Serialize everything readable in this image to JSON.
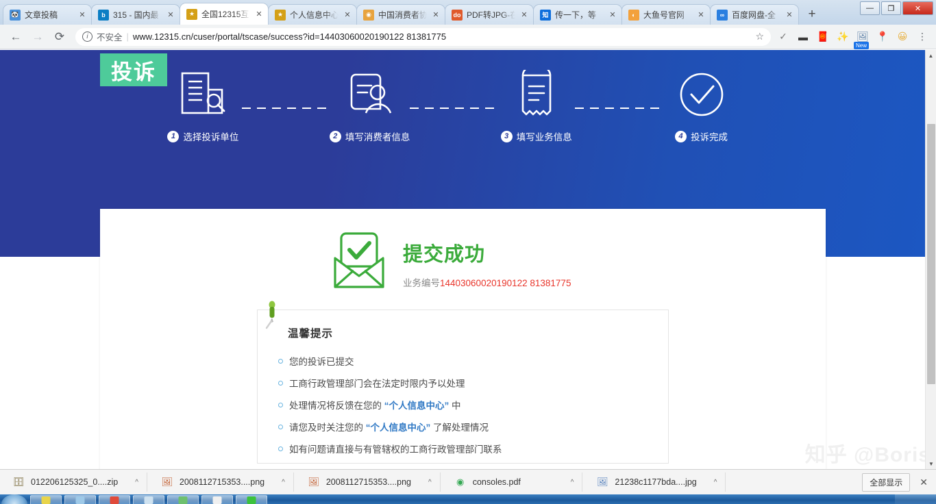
{
  "browser": {
    "tabs": [
      {
        "title": "文章投稿",
        "favicon": "panda-icon",
        "favicon_color": "#4a90d9",
        "favicon_text": "🐼",
        "active": false
      },
      {
        "title": "315 - 国内最",
        "favicon": "bing-icon",
        "favicon_color": "#0b7ec4",
        "favicon_text": "b",
        "active": false
      },
      {
        "title": "全国12315互",
        "favicon": "emblem-icon",
        "favicon_color": "#d4a017",
        "favicon_text": "★",
        "active": true
      },
      {
        "title": "个人信息中心",
        "favicon": "emblem-icon",
        "favicon_color": "#d4a017",
        "favicon_text": "★",
        "active": false
      },
      {
        "title": "中国消费者协",
        "favicon": "pin-icon",
        "favicon_color": "#e8a33d",
        "favicon_text": "◉",
        "active": false
      },
      {
        "title": "PDF转JPG-在",
        "favicon": "docsmall-icon",
        "favicon_color": "#e05a2b",
        "favicon_text": "do",
        "active": false
      },
      {
        "title": "传一下，等",
        "favicon": "zhihu-icon",
        "favicon_color": "#0f6fdc",
        "favicon_text": "知",
        "active": false
      },
      {
        "title": "大鱼号官网",
        "favicon": "dayu-icon",
        "favicon_color": "#f3a13c",
        "favicon_text": "◐",
        "active": false
      },
      {
        "title": "百度网盘-全",
        "favicon": "baidu-icon",
        "favicon_color": "#2a7fe0",
        "favicon_text": "∞",
        "active": false
      }
    ],
    "new_tab_label": "+",
    "tab_close_label": "✕",
    "window_controls": {
      "minimize": "—",
      "maximize": "❐",
      "close": "✕"
    },
    "nav": {
      "back": "←",
      "forward": "→",
      "reload": "⟳"
    },
    "omnibox": {
      "security_label": "不安全",
      "url": "www.12315.cn/cuser/portal/tscase/success?id=14403060020190122 81381775",
      "star": "☆"
    },
    "extensions": [
      {
        "name": "checkmark-icon",
        "glyph": "✓",
        "color": "#7a7a7a",
        "badge": ""
      },
      {
        "name": "bandicam-icon",
        "glyph": "▬",
        "color": "#3a3a3a",
        "badge": ""
      },
      {
        "name": "redpacket-icon",
        "glyph": "🧧",
        "color": "#d93025",
        "badge": ""
      },
      {
        "name": "magicwand-icon",
        "glyph": "✨",
        "color": "#e8b100",
        "badge": ""
      },
      {
        "name": "screenshot-icon",
        "glyph": "🖼",
        "color": "#5b7fa6",
        "badge": "New"
      },
      {
        "name": "location-pin-icon",
        "glyph": "📍",
        "color": "#e0452f",
        "badge": ""
      },
      {
        "name": "profile-avatar",
        "glyph": "😀",
        "color": "#e8b44a",
        "badge": ""
      },
      {
        "name": "chrome-menu-icon",
        "glyph": "⋮",
        "color": "#5f6368",
        "badge": ""
      }
    ]
  },
  "page": {
    "banner": {
      "badge_label": "投诉",
      "steps": [
        {
          "num": "1",
          "label": "选择投诉单位",
          "icon": "building-search-icon"
        },
        {
          "num": "2",
          "label": "填写消费者信息",
          "icon": "user-document-icon"
        },
        {
          "num": "3",
          "label": "填写业务信息",
          "icon": "receipt-icon"
        },
        {
          "num": "4",
          "label": "投诉完成",
          "icon": "check-circle-icon"
        }
      ]
    },
    "success": {
      "icon": "envelope-check-icon",
      "title": "提交成功",
      "case_label": "业务编号",
      "case_number": "14403060020190122 81381775"
    },
    "tips": {
      "pin_icon": "pushpin-icon",
      "heading": "温馨提示",
      "items": [
        {
          "parts": [
            {
              "text": "您的投诉已提交",
              "highlight": false
            }
          ]
        },
        {
          "parts": [
            {
              "text": "工商行政管理部门会在法定时限内予以处理",
              "highlight": false
            }
          ]
        },
        {
          "parts": [
            {
              "text": "处理情况将反馈在您的 ",
              "highlight": false
            },
            {
              "text": "“个人信息中心”",
              "highlight": true
            },
            {
              "text": " 中",
              "highlight": false
            }
          ]
        },
        {
          "parts": [
            {
              "text": "请您及时关注您的 ",
              "highlight": false
            },
            {
              "text": "“个人信息中心”",
              "highlight": true
            },
            {
              "text": " 了解处理情况",
              "highlight": false
            }
          ]
        },
        {
          "parts": [
            {
              "text": "如有问题请直接与有管辖权的工商行政管理部门联系",
              "highlight": false
            }
          ]
        }
      ]
    },
    "watermark": "知乎 @Boris",
    "scrollbar": {
      "up": "▲",
      "down": "▼"
    }
  },
  "downloads": {
    "items": [
      {
        "filename": "012206125325_0....zip",
        "icon": "zip-icon",
        "glyph": "🗄",
        "color": "#7a6a3a"
      },
      {
        "filename": "2008112715353....png",
        "icon": "image-icon",
        "glyph": "🖼",
        "color": "#c05a2b"
      },
      {
        "filename": "2008112715353....png",
        "icon": "image-icon",
        "glyph": "🖼",
        "color": "#c05a2b"
      },
      {
        "filename": "consoles.pdf",
        "icon": "chrome-icon",
        "glyph": "◉",
        "color": "#34a853"
      },
      {
        "filename": "21238c1177bda....jpg",
        "icon": "image-icon",
        "glyph": "🖼",
        "color": "#4a78b8"
      }
    ],
    "caret": "^",
    "show_all_label": "全部显示",
    "close_label": "✕"
  },
  "taskbar": {
    "items": [
      {
        "name": "taskbar-item-1",
        "color": "#e8d44a"
      },
      {
        "name": "taskbar-item-2",
        "color": "#9ec9e8"
      },
      {
        "name": "taskbar-item-3",
        "color": "#e04a3a"
      },
      {
        "name": "taskbar-item-4",
        "color": "#cfe2f0"
      },
      {
        "name": "taskbar-item-5",
        "color": "#6ec06e"
      },
      {
        "name": "taskbar-item-6",
        "color": "#f0f0f0"
      },
      {
        "name": "taskbar-item-7",
        "color": "#3cc23c"
      }
    ]
  },
  "colors": {
    "banner_blue_dark": "#2c3c99",
    "banner_blue_light": "#1c57c2",
    "badge_green": "#4ecb9a",
    "success_green": "#3bab3b",
    "case_red": "#e8342a",
    "link_blue": "#2f78c4"
  }
}
